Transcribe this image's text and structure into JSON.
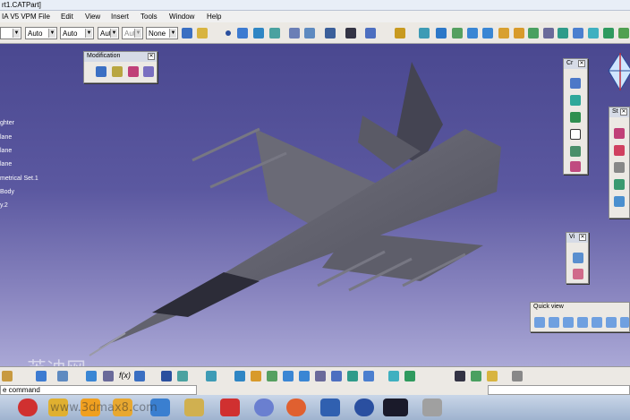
{
  "window": {
    "title": "rt1.CATPart]"
  },
  "menu": {
    "product": "IA V5 VPM",
    "items": [
      "File",
      "Edit",
      "View",
      "Insert",
      "Tools",
      "Window",
      "Help"
    ]
  },
  "toolbar": {
    "combos": [
      "",
      "Auto",
      "Auto",
      "Aut",
      "Aut",
      "None"
    ]
  },
  "tree": {
    "items": [
      "ghter",
      "lane",
      "lane",
      "lane",
      "metrical Set.1",
      "Body",
      "y.2"
    ]
  },
  "panels": {
    "modification": {
      "title": "Modification"
    },
    "creation": {
      "title": "Cr"
    },
    "sketch": {
      "title": "St"
    },
    "view": {
      "title": "Vi"
    },
    "quickview": {
      "title": "Quick view"
    }
  },
  "bottom": {
    "function_label": "f(x)"
  },
  "command": {
    "label": "e command"
  },
  "watermark": {
    "text": "英迪网",
    "url": "www.3dmax8.com"
  },
  "colors": {
    "background": "#4a4890",
    "aircraft": "#5f5f6b",
    "panel": "#ece9e4"
  }
}
